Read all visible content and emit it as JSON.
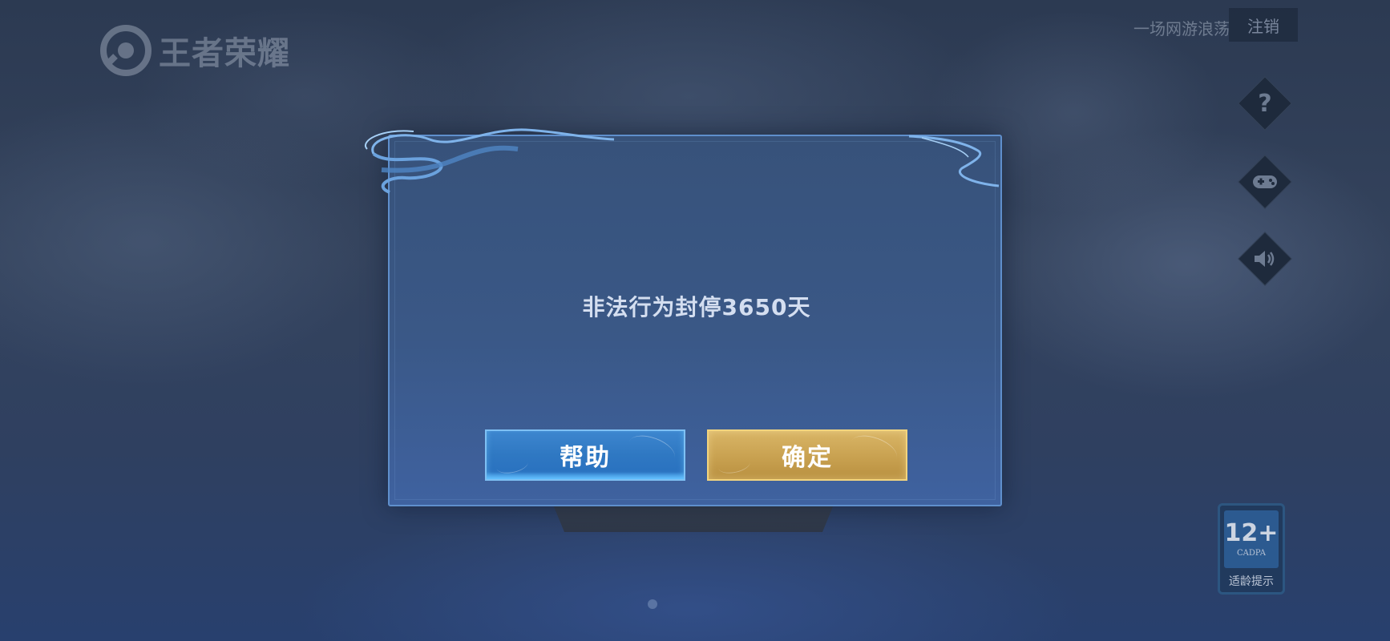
{
  "header": {
    "logo_text": "王者荣耀",
    "account_name": "一场网游浪荡",
    "logout_label": "注销"
  },
  "side_buttons": {
    "help_glyph": "?",
    "gamepad_glyph": "🎮",
    "sound_glyph": "🔊"
  },
  "dialog": {
    "message": "非法行为封停3650天",
    "help_button": "帮助",
    "confirm_button": "确定"
  },
  "age_rating": {
    "age": "12+",
    "org": "CADPA",
    "label": "适龄提示"
  },
  "colors": {
    "dialog_border": "#5f8fcc",
    "help_button": "#2f78c2",
    "confirm_button": "#caa352"
  }
}
